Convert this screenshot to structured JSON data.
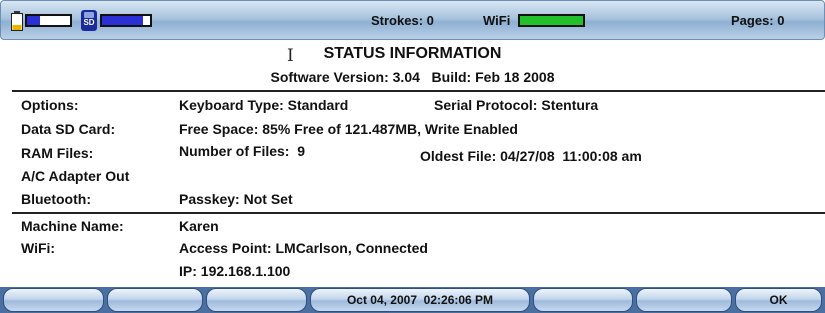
{
  "status_bar": {
    "strokes": "Strokes: 0",
    "wifi_label": "WiFi",
    "pages": "Pages: 0",
    "battery_level": 0.3,
    "storage_level": 0.85,
    "wifi_signal_level": 1.0,
    "colors": {
      "bar_fill": "#2b2fd6",
      "wifi_fill": "#22c02a",
      "battery": "#e8b400"
    }
  },
  "header": {
    "title": "STATUS INFORMATION",
    "software_version": "Software Version: 3.04   Build: Feb 18 2008"
  },
  "rows": {
    "options": {
      "label": "Options:",
      "keyboard": "Keyboard Type: Standard",
      "serial": "Serial Protocol: Stentura"
    },
    "sd_card": {
      "label": "Data SD Card:",
      "value": "Free Space: 85% Free of 121.487MB, Write Enabled"
    },
    "ram_files": {
      "label": "RAM Files:",
      "count": "Number of Files:  9",
      "oldest": "Oldest File: 04/27/08  11:00:08 am"
    },
    "ac_adapter": {
      "label": "A/C Adapter Out"
    },
    "bluetooth": {
      "label": "Bluetooth:",
      "value": "Passkey: Not Set"
    },
    "machine_name": {
      "label": "Machine Name:",
      "value": "Karen"
    },
    "wifi": {
      "label": "WiFi:",
      "access_point": "Access Point: LMCarlson, Connected",
      "ip": "IP: 192.168.1.100"
    }
  },
  "softkeys": {
    "datetime": "Oct 04, 2007  02:26:06 PM",
    "ok": "OK"
  }
}
